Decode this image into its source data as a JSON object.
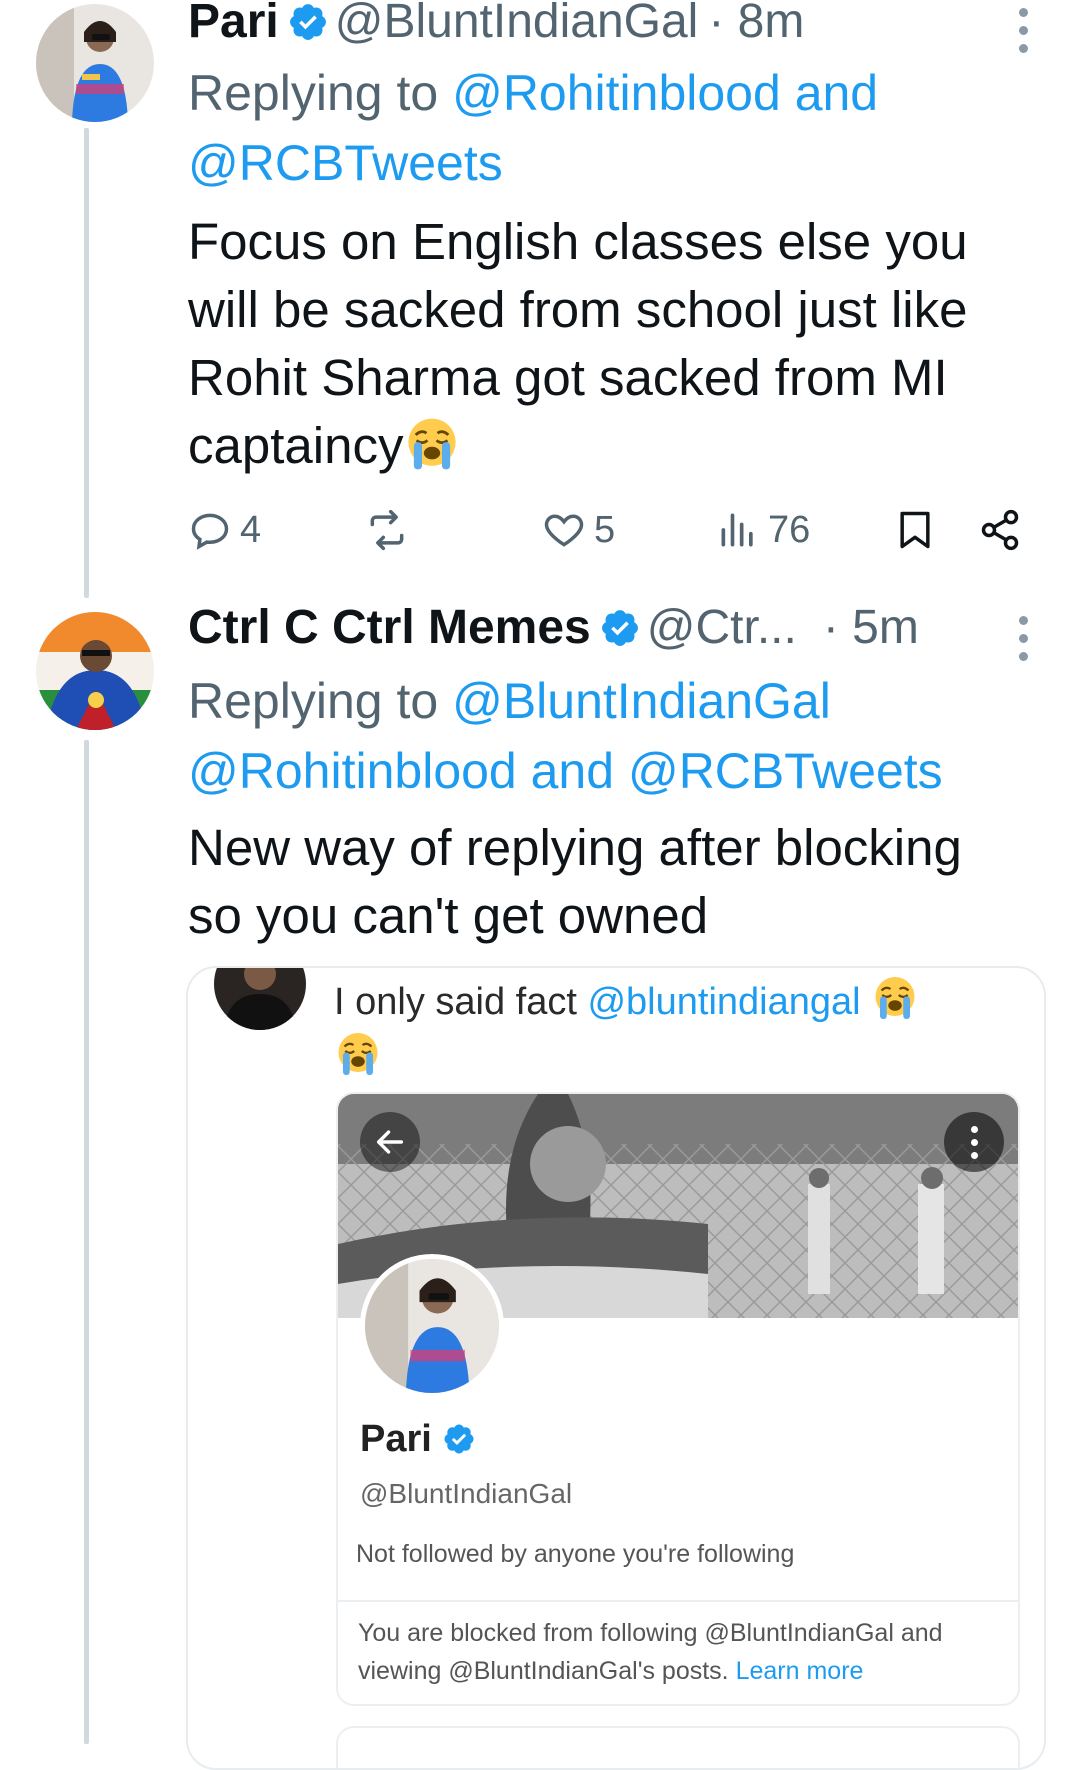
{
  "tweet1": {
    "name": "Pari",
    "handle": "@BluntIndianGal",
    "time": "· 8m",
    "replying_prefix": "Replying to",
    "replying_line1": "@Rohitinblood and",
    "replying_line2": "@RCBTweets",
    "text_lines": [
      "Focus on English classes else you",
      "will be sacked from school just like",
      "Rohit Sharma got sacked from MI",
      "captaincy"
    ],
    "emoji": "loudly-crying-face-emoji",
    "replies": "4",
    "likes": "5",
    "views": "76"
  },
  "tweet2": {
    "name": "Ctrl C Ctrl Memes",
    "handle": "@Ctr...",
    "time": "· 5m",
    "replying_prefix": "Replying to",
    "replying_line1": "@BluntIndianGal",
    "replying_line2": "@Rohitinblood and @RCBTweets",
    "text_lines": [
      "New way of replying after blocking",
      "so you can't get owned"
    ]
  },
  "quote": {
    "text": "I only said fact",
    "mention": "@bluntindiangal",
    "profile": {
      "name": "Pari",
      "handle": "@BluntIndianGal",
      "not_followed": "Not followed by anyone you're following",
      "blocked_line1": "You are blocked from following @BluntIndianGal and",
      "blocked_line2": "viewing @BluntIndianGal's posts.",
      "learn_more": "Learn more"
    }
  },
  "colors": {
    "accent": "#1d9bf0",
    "muted": "#536471",
    "text": "#0f1419"
  }
}
